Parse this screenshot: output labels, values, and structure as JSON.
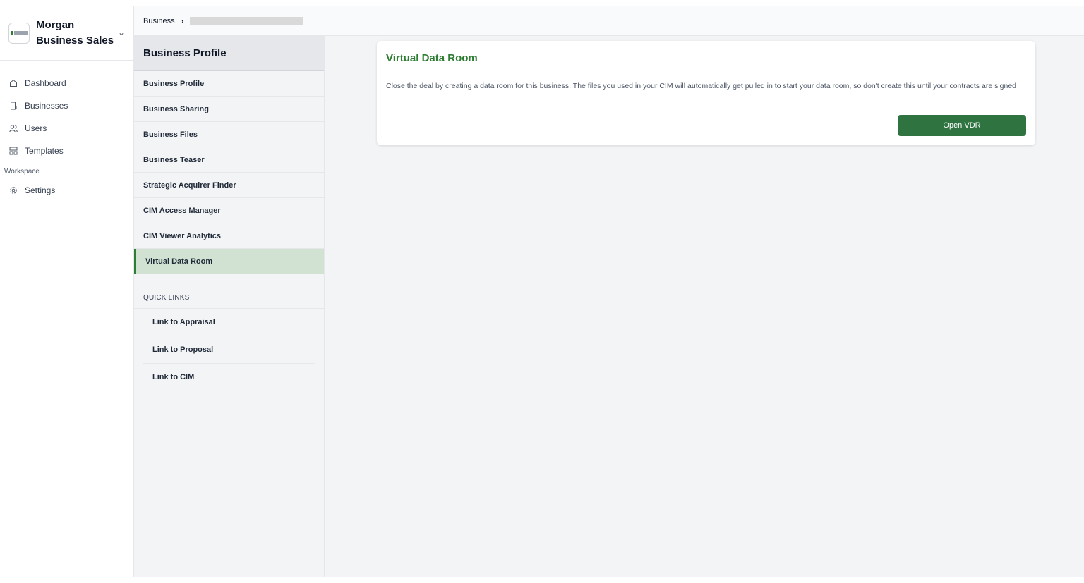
{
  "brand": {
    "name": "Morgan Business Sales"
  },
  "nav": {
    "items": [
      {
        "label": "Dashboard",
        "icon": "home-icon"
      },
      {
        "label": "Businesses",
        "icon": "building-icon"
      },
      {
        "label": "Users",
        "icon": "users-icon"
      },
      {
        "label": "Templates",
        "icon": "templates-icon"
      }
    ],
    "section_label": "Workspace",
    "settings_label": "Settings"
  },
  "breadcrumb": {
    "root": "Business"
  },
  "subnav": {
    "header": "Business Profile",
    "items": [
      "Business Profile",
      "Business Sharing",
      "Business Files",
      "Business Teaser",
      "Strategic Acquirer Finder",
      "CIM Access Manager",
      "CIM Viewer Analytics",
      "Virtual Data Room"
    ],
    "active_item": "Virtual Data Room",
    "quick_links_title": "QUICK LINKS",
    "quick_links": [
      "Link to Appraisal",
      "Link to Proposal",
      "Link to CIM"
    ]
  },
  "vdr_card": {
    "title": "Virtual Data Room",
    "description": "Close the deal by creating a data room for this business. The files you used in your CIM will automatically get pulled in to start your data room, so don't create this until your contracts are signed",
    "button_label": "Open VDR"
  },
  "colors": {
    "accent": "#2e7d32",
    "button": "#2e7340",
    "active_bg": "#d1e2d3"
  }
}
